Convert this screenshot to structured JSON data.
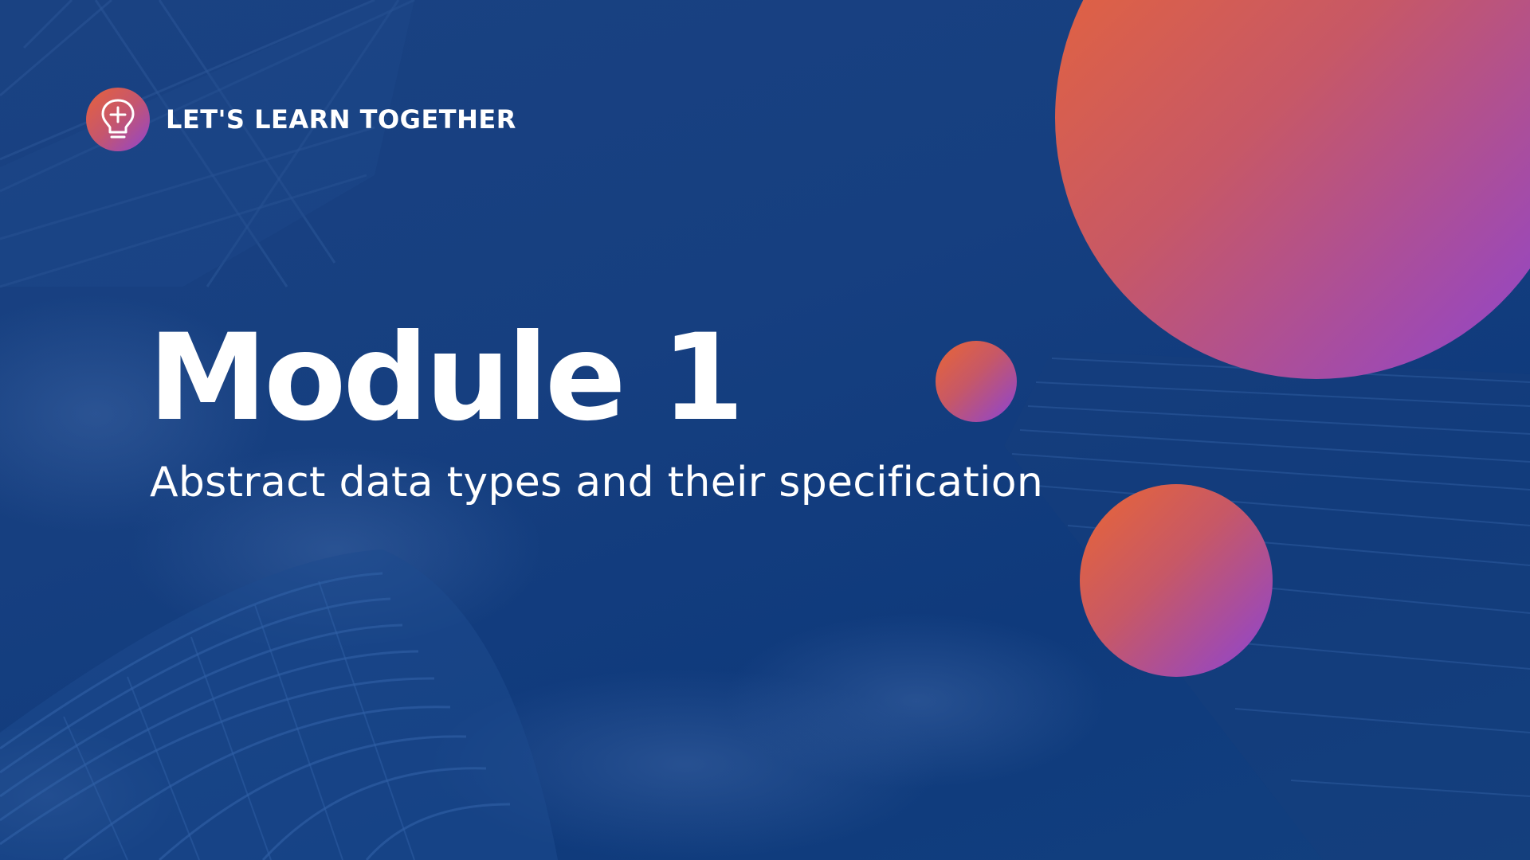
{
  "slide": {
    "brand": {
      "icon": "lightbulb-plus-icon",
      "text": "LET'S LEARN TOGETHER"
    },
    "title": "Module 1",
    "subtitle": "Abstract data types and their specification"
  },
  "colors": {
    "background": "#17407e",
    "text": "#ffffff",
    "orb_gradient_start": "#ea6634",
    "orb_gradient_mid": "#c75866",
    "orb_gradient_end": "#8b43d6"
  }
}
